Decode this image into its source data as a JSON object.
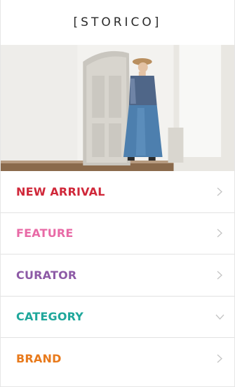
{
  "header": {
    "logo_text": "[STORICO]"
  },
  "hero": {
    "image_alt": "photo"
  },
  "menu": [
    {
      "label": "NEW ARRIVAL",
      "color": "#d0283a",
      "chevron": "chevron-right-icon"
    },
    {
      "label": "FEATURE",
      "color": "#e86aa6",
      "chevron": "chevron-right-icon"
    },
    {
      "label": "CURATOR",
      "color": "#8d5aa6",
      "chevron": "chevron-right-icon"
    },
    {
      "label": "CATEGORY",
      "color": "#1fa79b",
      "chevron": "chevron-down-icon"
    },
    {
      "label": "BRAND",
      "color": "#e87a1c",
      "chevron": "chevron-right-icon"
    }
  ],
  "colors": {
    "divider": "#e2e2e2",
    "chevron": "#c4c4c4"
  }
}
